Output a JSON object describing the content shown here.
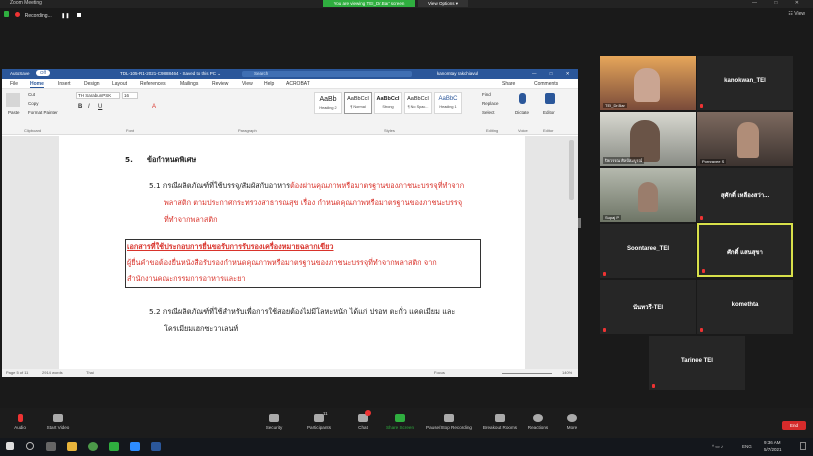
{
  "zoom": {
    "title": "Zoom Meeting",
    "share_banner": "You are viewing TEI_Dr.Bar' screen",
    "view_options": "View Options ▾",
    "window_controls": "—  □  ✕",
    "recording": "Recording...",
    "view": "☷ View"
  },
  "word": {
    "autosave": "AutoSave",
    "toggle": "Off",
    "doc_title": "TDL-105-R1-2021-C9888464 - Saved to this PC ⌄",
    "search_placeholder": "Search",
    "user": "kanomtay rakchiavul",
    "tabs": [
      "File",
      "Home",
      "Insert",
      "Design",
      "Layout",
      "References",
      "Mailings",
      "Review",
      "View",
      "Help",
      "ACROBAT"
    ],
    "share": "Share",
    "comments": "Comments",
    "clipboard": {
      "paste": "Paste",
      "cut": "Cut",
      "copy": "Copy",
      "format_painter": "Format Painter",
      "label": "Clipboard"
    },
    "font": {
      "name": "TH SarabunPSK",
      "size": "16",
      "label": "Font"
    },
    "paragraph_label": "Paragraph",
    "styles": [
      {
        "preview": "AaBb",
        "name": "Heading 2"
      },
      {
        "preview": "AaBbCcI",
        "name": "¶ Normal"
      },
      {
        "preview": "AaBbCcI",
        "name": "Strong"
      },
      {
        "preview": "AaBbCcI",
        "name": "¶ No Spac..."
      },
      {
        "preview": "AaBbC",
        "name": "Heading 1"
      }
    ],
    "styles_label": "Styles",
    "editing": {
      "find": "Find",
      "replace": "Replace",
      "select": "Select",
      "label": "Editing"
    },
    "dictate": "Dictate",
    "voice_label": "Voice",
    "editor": "Editor",
    "editor_label": "Editor",
    "status": {
      "page": "Page 5 of 11",
      "words": "2914 words",
      "lang": "Thai",
      "focus": "Focus",
      "zoom": "140%"
    }
  },
  "document": {
    "heading_num": "5.",
    "heading": "ข้อกำหนดพิเศษ",
    "p51_l1_black": "5.1 กรณีผลิตภัณฑ์ที่ใช้บรรจุ/สัมผัสกับอาหาร",
    "p51_l1_red": "ต้องผ่านคุณภาพหรือมาตรฐานของภาชนะบรรจุที่ทำจาก",
    "p51_l2": "พลาสติก ตามประกาศกระทรวงสาธารณสุข เรื่อง กำหนดคุณภาพหรือมาตรฐานของภาชนะบรรจุ",
    "p51_l3": "ที่ทำจากพลาสติก",
    "box_title": "เอกสารที่ใช้ประกอบการยื่นขอรับการรับรองเครื่องหมายฉลากเขียว",
    "box_l2": "ผู้ยื่นคำขอต้องยื่นหนังสือรับรองกำหนดคุณภาพหรือมาตรฐานของภาชนะบรรจุที่ทำจากพลาสติก จาก",
    "box_l3": "สำนักงานคณะกรรมการอาหารและยา",
    "p52_l1": "5.2 กรณีผลิตภัณฑ์ที่ใช้สำหรับเพื่อการใช้สอยต้องไม่มีโลหะหนัก ได้แก่ ปรอท ตะกั่ว แคดเมียม และ",
    "p52_l2": "โครเมียมเฮกซะวาเลนท์"
  },
  "participants": [
    {
      "name": "TEI_Dr.Bar",
      "video": true
    },
    {
      "name": "kanokwan_TEI",
      "video": false
    },
    {
      "name": "ปิยวรรณ ศิลป์สมบูรณ์",
      "video": true
    },
    {
      "name": "Pornravee S",
      "video": true
    },
    {
      "name": "Supaj P",
      "video": true
    },
    {
      "name": "สุศักดิ์ เหลืองสว่า...",
      "video": false
    },
    {
      "name": "Soontaree_TEI",
      "video": false
    },
    {
      "name": "ศักดิ์ แสนสุขา",
      "video": false
    },
    {
      "name": "นันทวรี-TEI",
      "video": false
    },
    {
      "name": "komethta",
      "video": false
    },
    {
      "name": "Tarinee TEI",
      "video": false
    }
  ],
  "toolbar": {
    "audio": "Audio",
    "video": "Start Video",
    "security": "Security",
    "participants": "Participants",
    "participants_count": "11",
    "chat": "Chat",
    "share": "Share Screen",
    "record": "Pause/Stop Recording",
    "breakout": "Breakout Rooms",
    "reactions": "Reactions",
    "more": "More",
    "end": "End"
  },
  "taskbar": {
    "lang": "ENG",
    "time": "9:36 AM",
    "date": "5/7/2021"
  },
  "colors": {
    "accent_green": "#2fae3f",
    "word_blue": "#2b579a",
    "doc_red": "#d9332b",
    "end_red": "#d62b2b",
    "active_speaker": "#d8e04a"
  }
}
